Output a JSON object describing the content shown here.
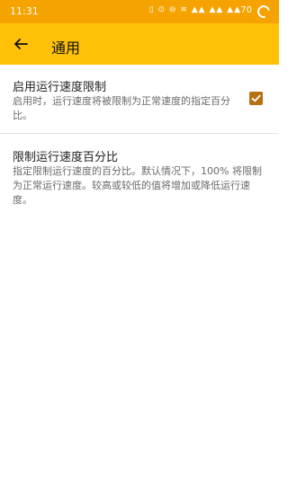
{
  "status_bar": {
    "time": "11:31",
    "icons_text": "▯ ⊙ ⊖ ≋ ▲▲ ▲▲ ▲▲",
    "battery": "70"
  },
  "app_bar": {
    "title": "通用",
    "back_icon": "arrow-left-icon"
  },
  "preferences": [
    {
      "title": "启用运行速度限制",
      "summary": "启用时，运行速度将被限制为正常速度的指定百分比。",
      "checked": true
    },
    {
      "title": "限制运行速度百分比",
      "summary": "指定限制运行速度的百分比。默认情况下，100% 将限制为正常运行速度。较高或较低的值将增加或降低运行速度。"
    }
  ],
  "colors": {
    "status_bar": "#f5a300",
    "app_bar": "#ffc107",
    "checkbox": "#b5720f"
  }
}
